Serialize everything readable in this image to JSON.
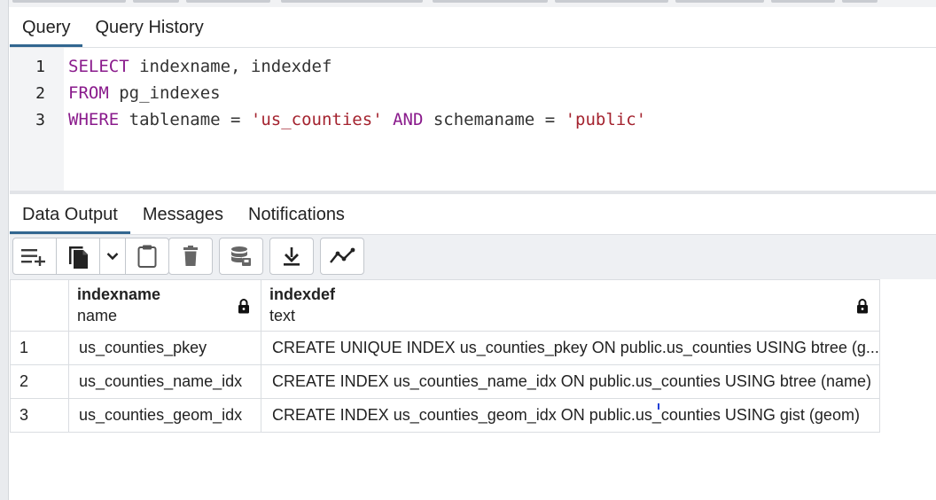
{
  "query_tabs": [
    {
      "label": "Query",
      "active": true
    },
    {
      "label": "Query History",
      "active": false
    }
  ],
  "editor": {
    "lines": [
      {
        "num": "1",
        "tokens": [
          {
            "t": "SELECT",
            "k": "kw"
          },
          {
            "t": " indexname, indexdef",
            "k": "plain"
          }
        ]
      },
      {
        "num": "2",
        "tokens": [
          {
            "t": "FROM",
            "k": "kw"
          },
          {
            "t": " pg_indexes",
            "k": "plain"
          }
        ]
      },
      {
        "num": "3",
        "tokens": [
          {
            "t": "WHERE",
            "k": "kw"
          },
          {
            "t": " tablename = ",
            "k": "plain"
          },
          {
            "t": "'us_counties'",
            "k": "str"
          },
          {
            "t": " ",
            "k": "plain"
          },
          {
            "t": "AND",
            "k": "kw"
          },
          {
            "t": " schemaname = ",
            "k": "plain"
          },
          {
            "t": "'public'",
            "k": "str"
          }
        ]
      }
    ]
  },
  "output_tabs": [
    {
      "label": "Data Output",
      "active": true
    },
    {
      "label": "Messages",
      "active": false
    },
    {
      "label": "Notifications",
      "active": false
    }
  ],
  "toolbar": {
    "icons": [
      "add-row-icon",
      "copy-icon",
      "chevron-down-icon",
      "paste-icon",
      "delete-icon",
      "save-data-icon",
      "download-icon",
      "graph-icon"
    ]
  },
  "grid": {
    "columns": [
      {
        "name": "indexname",
        "type": "name",
        "locked": true
      },
      {
        "name": "indexdef",
        "type": "text",
        "locked": true
      }
    ],
    "rows": [
      {
        "num": "1",
        "indexname": "us_counties_pkey",
        "indexdef": "CREATE UNIQUE INDEX us_counties_pkey ON public.us_counties USING btree (g..."
      },
      {
        "num": "2",
        "indexname": "us_counties_name_idx",
        "indexdef": "CREATE INDEX us_counties_name_idx ON public.us_counties USING btree (name)"
      },
      {
        "num": "3",
        "indexname": "us_counties_geom_idx",
        "indexdef": "CREATE INDEX us_counties_geom_idx ON public.us_counties USING gist (geom)"
      }
    ]
  },
  "colors": {
    "accent": "#326690",
    "keyword": "#8a1b8c",
    "string": "#a4232f"
  }
}
